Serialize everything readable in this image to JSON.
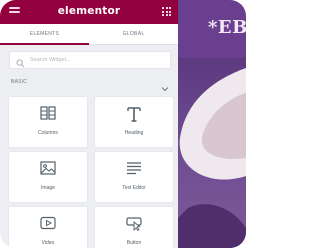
{
  "header": {
    "brand": "elementor",
    "menu_icon": "hamburger-icon",
    "apps_icon": "grid-icon",
    "accent_color": "#93003f"
  },
  "tabs": [
    {
      "label": "ELEMENTS",
      "active": true
    },
    {
      "label": "GLOBAL",
      "active": false
    }
  ],
  "search": {
    "placeholder": "Search Widget..."
  },
  "section": {
    "label": "BASIC",
    "expanded": true
  },
  "widgets": [
    {
      "label": "Columns",
      "icon": "columns-icon"
    },
    {
      "label": "Heading",
      "icon": "heading-icon"
    },
    {
      "label": "Image",
      "icon": "image-icon"
    },
    {
      "label": "Text Editor",
      "icon": "text-editor-icon"
    },
    {
      "label": "Video",
      "icon": "video-icon"
    },
    {
      "label": "Button",
      "icon": "button-icon"
    }
  ],
  "preview": {
    "heading": "*EBC",
    "band_color": "#6b3f8f"
  }
}
